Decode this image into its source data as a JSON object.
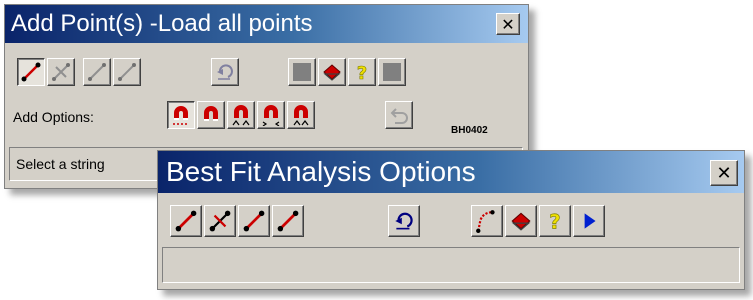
{
  "add_window": {
    "title": "Add Point(s) -Load all points",
    "close_label": "✕",
    "add_options_label": "Add Options:",
    "status_text": "Select a string",
    "code": "BH0402",
    "toolbar_icons": [
      "line-point-icon",
      "line-cross-icon",
      "line-dim-icon",
      "line-dim-icon",
      "undo-icon",
      "blank-icon",
      "book-icon",
      "help-icon",
      "blank-icon"
    ],
    "magnet_icons": [
      "magnet-dotted-icon",
      "magnet-icon",
      "magnet-arrows-in-icon",
      "magnet-arrows-side-icon",
      "magnet-arrows-up-icon",
      "undo-arrow-icon"
    ]
  },
  "best_fit_window": {
    "title": "Best Fit Analysis Options",
    "close_label": "✕",
    "status_text": "",
    "toolbar_icons": [
      "line-point-icon",
      "line-cross-icon",
      "line-point-icon",
      "line-point-icon",
      "undo-icon",
      "curve-icon",
      "book-icon",
      "help-icon",
      "play-icon"
    ]
  },
  "colors": {
    "title_start": "#0a246a",
    "title_end": "#a6caf0",
    "face": "#d4d0c8",
    "magnet_red": "#cc0000"
  }
}
